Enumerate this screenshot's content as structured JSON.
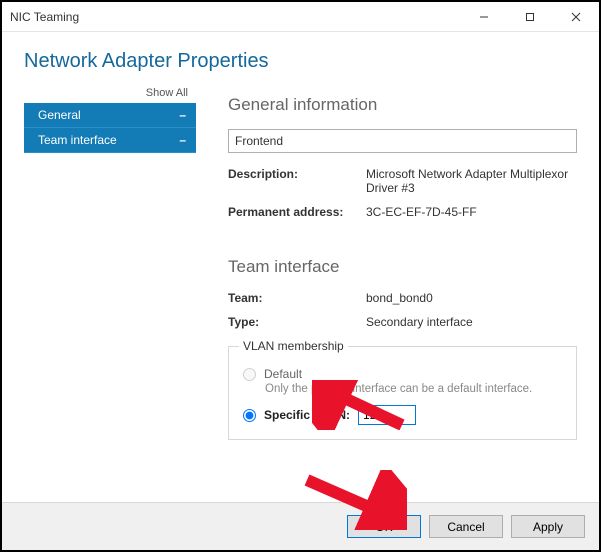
{
  "window": {
    "title": "NIC Teaming"
  },
  "header": {
    "title": "Network Adapter Properties"
  },
  "sidebar": {
    "show_all": "Show All",
    "items": [
      {
        "label": "General"
      },
      {
        "label": "Team interface"
      }
    ]
  },
  "general": {
    "section_title": "General information",
    "name_value": "Frontend",
    "desc_label": "Description:",
    "desc_value": "Microsoft Network Adapter Multiplexor Driver #3",
    "addr_label": "Permanent address:",
    "addr_value": "3C-EC-EF-7D-45-FF"
  },
  "team_if": {
    "section_title": "Team interface",
    "team_label": "Team:",
    "team_value": "bond_bond0",
    "type_label": "Type:",
    "type_value": "Secondary interface"
  },
  "vlan": {
    "legend": "VLAN membership",
    "default_label": "Default",
    "hint": "Only the primary interface can be a default interface.",
    "specific_label": "Specific VLAN:",
    "specific_value": "12"
  },
  "footer": {
    "ok": "OK",
    "cancel": "Cancel",
    "apply": "Apply"
  }
}
